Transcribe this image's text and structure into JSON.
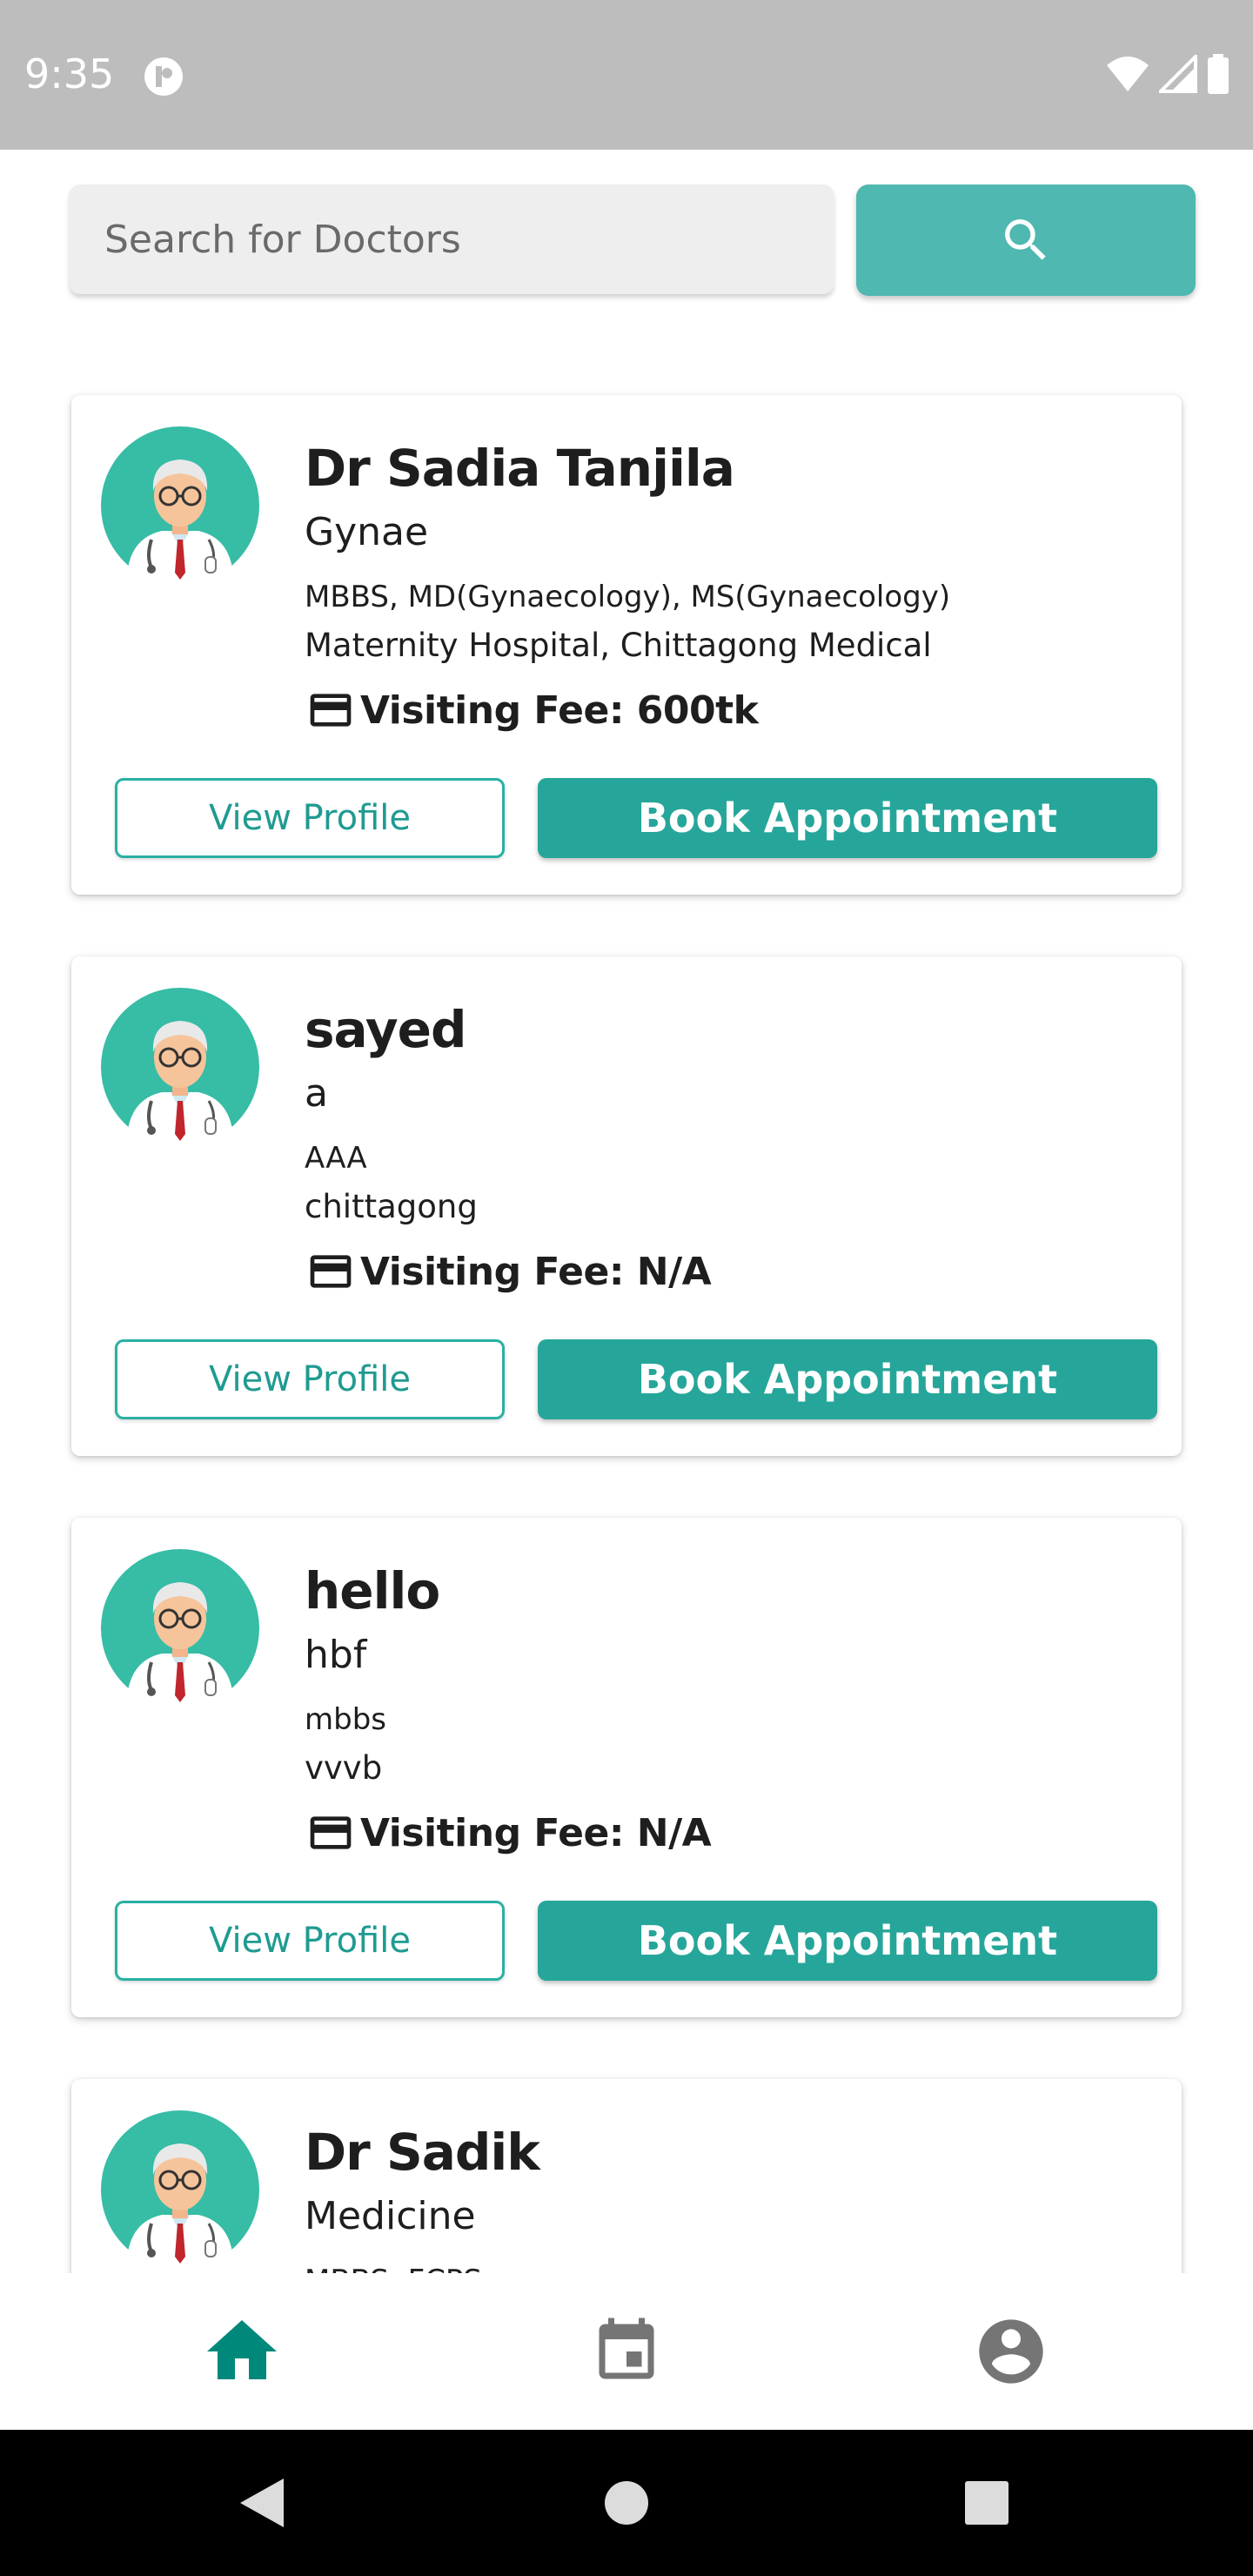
{
  "status_bar": {
    "time": "9:35"
  },
  "search": {
    "placeholder": "Search for Doctors",
    "value": ""
  },
  "doctors": [
    {
      "name": "Dr Sadia Tanjila",
      "specialty": "Gynae",
      "degree": "MBBS, MD(Gynaecology), MS(Gynaecology)",
      "hospital": "Maternity Hospital, Chittagong Medical",
      "fee": "Visiting Fee: 600tk"
    },
    {
      "name": "sayed",
      "specialty": "a",
      "degree": "AAA",
      "hospital": "chittagong",
      "fee": "Visiting Fee: N/A"
    },
    {
      "name": "hello",
      "specialty": "hbf",
      "degree": "mbbs",
      "hospital": "vvvb",
      "fee": "Visiting Fee: N/A"
    },
    {
      "name": "Dr Sadik",
      "specialty": "Medicine",
      "degree": "MBBS, FCPS",
      "hospital": "",
      "fee": ""
    }
  ],
  "buttons": {
    "view_profile": "View Profile",
    "book_appointment": "Book Appointment"
  },
  "bottom_nav": [
    {
      "icon": "home-icon",
      "active": true
    },
    {
      "icon": "calendar-icon",
      "active": false
    },
    {
      "icon": "account-icon",
      "active": false
    }
  ],
  "colors": {
    "accent": "#26a69a",
    "search_button": "#4fb8b0",
    "status_bar": "#bdbdbd",
    "nav_inactive": "#757575"
  }
}
